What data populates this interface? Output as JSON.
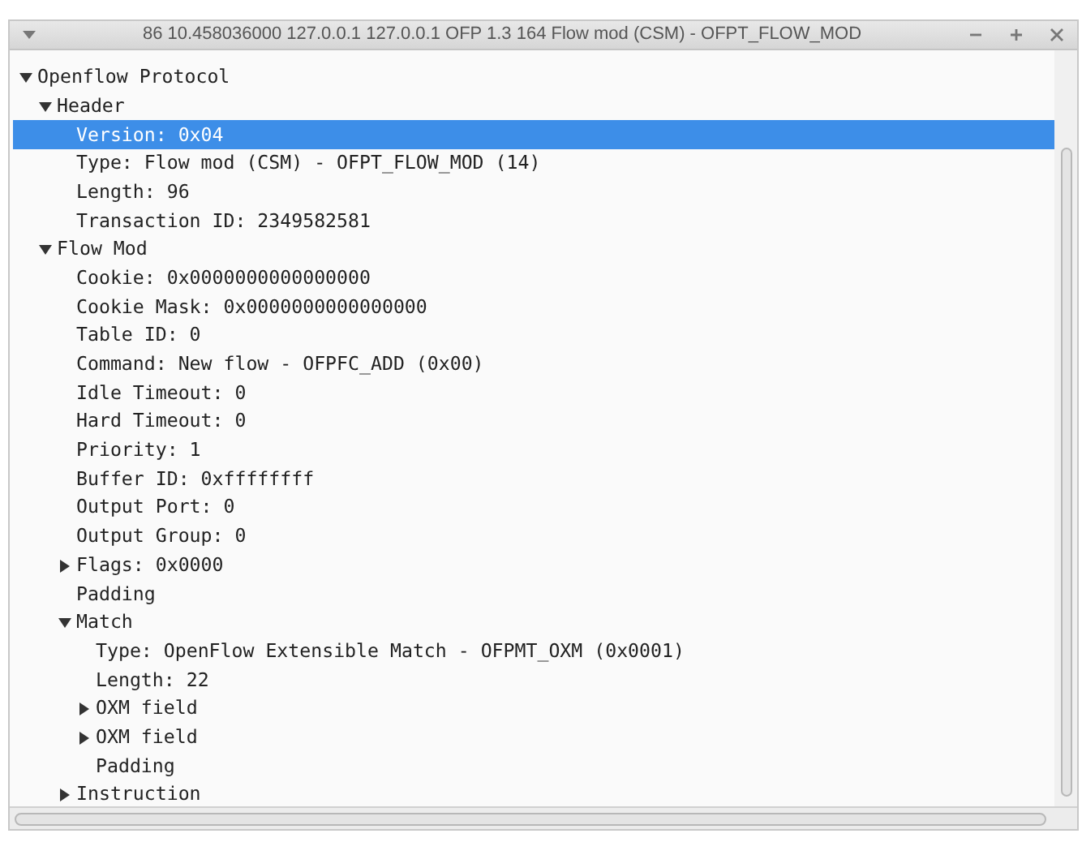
{
  "window": {
    "title": "86 10.458036000 127.0.0.1 127.0.0.1 OFP 1.3 164 Flow mod (CSM) - OFPT_FLOW_MOD"
  },
  "tree": [
    {
      "label": "Openflow Protocol",
      "expanded": true,
      "selected": false,
      "children": [
        {
          "label": "Header",
          "expanded": true,
          "selected": false,
          "children": [
            {
              "label": "Version: 0x04",
              "selected": true
            },
            {
              "label": "Type: Flow mod (CSM) - OFPT_FLOW_MOD (14)",
              "selected": false
            },
            {
              "label": "Length: 96",
              "selected": false
            },
            {
              "label": "Transaction ID: 2349582581",
              "selected": false
            }
          ]
        },
        {
          "label": "Flow Mod",
          "expanded": true,
          "selected": false,
          "children": [
            {
              "label": "Cookie: 0x0000000000000000",
              "selected": false
            },
            {
              "label": "Cookie Mask: 0x0000000000000000",
              "selected": false
            },
            {
              "label": "Table ID: 0",
              "selected": false
            },
            {
              "label": "Command: New flow - OFPFC_ADD (0x00)",
              "selected": false
            },
            {
              "label": "Idle Timeout: 0",
              "selected": false
            },
            {
              "label": "Hard Timeout: 0",
              "selected": false
            },
            {
              "label": "Priority: 1",
              "selected": false
            },
            {
              "label": "Buffer ID: 0xffffffff",
              "selected": false
            },
            {
              "label": "Output Port: 0",
              "selected": false
            },
            {
              "label": "Output Group: 0",
              "selected": false
            },
            {
              "label": "Flags: 0x0000",
              "expanded": false,
              "selected": false
            },
            {
              "label": "Padding",
              "selected": false
            },
            {
              "label": "Match",
              "expanded": true,
              "selected": false,
              "children": [
                {
                  "label": "Type: OpenFlow Extensible Match - OFPMT_OXM (0x0001)",
                  "selected": false
                },
                {
                  "label": "Length: 22",
                  "selected": false
                },
                {
                  "label": "OXM field",
                  "expanded": false,
                  "selected": false
                },
                {
                  "label": "OXM field",
                  "expanded": false,
                  "selected": false
                },
                {
                  "label": "Padding",
                  "selected": false
                }
              ]
            },
            {
              "label": "Instruction",
              "expanded": false,
              "selected": false
            }
          ]
        }
      ]
    }
  ]
}
